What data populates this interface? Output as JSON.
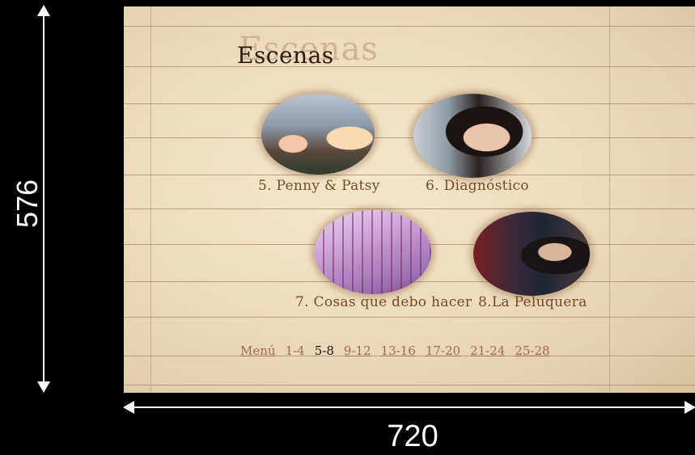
{
  "dimensions": {
    "height_label": "576",
    "width_label": "720"
  },
  "screen": {
    "title": "Escenas",
    "title_shadow": "Escenas",
    "scenes": [
      {
        "caption": "5. Penny & Patsy"
      },
      {
        "caption": "6. Diagnóstico"
      },
      {
        "caption": "7. Cosas que debo hacer"
      },
      {
        "caption": "8.La Peluquera"
      }
    ],
    "menu": {
      "label": "Menú",
      "pages": [
        "1-4",
        "5-8",
        "9-12",
        "13-16",
        "17-20",
        "21-24",
        "25-28"
      ],
      "current": "5-8"
    }
  },
  "colors": {
    "paper": "#ecdcbf",
    "ink": "#2d1c12",
    "caption": "#7a4a25",
    "link": "#a06a55"
  }
}
